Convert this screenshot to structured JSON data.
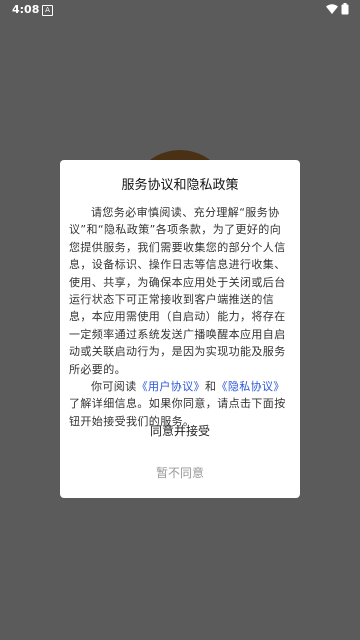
{
  "status_bar": {
    "time": "4:08",
    "notification_icon": "A",
    "icons": [
      "wifi-icon",
      "battery-icon"
    ]
  },
  "dialog": {
    "title": "服务协议和隐私政策",
    "paragraph1": "请您务必审慎阅读、充分理解“服务协议”和“隐私政策”各项条款，为了更好的向您提供服务，我们需要收集您的部分个人信息，设备标识、操作日志等信息进行收集、使用、共享，为确保本应用处于关闭或后台运行状态下可正常接收到客户端推送的信息，本应用需使用（自启动）能力，将存在一定频率通过系统发送广播唤醒本应用自启动或关联启动行为，是因为实现功能及服务所必要的。",
    "p2_prefix": "你可阅读",
    "user_agreement_link": "《用户协议》",
    "p2_and": "和",
    "privacy_policy_link": "《隐私协议》",
    "p2_suffix": "了解详细信息。如果你同意，请点击下面按钮开始接受我们的服务。",
    "agree_label": "同意并接受",
    "disagree_label": "暂不同意"
  },
  "colors": {
    "overlay": "#5b5b5b",
    "link": "#2b55d6",
    "background_circle": "#4a3116"
  }
}
